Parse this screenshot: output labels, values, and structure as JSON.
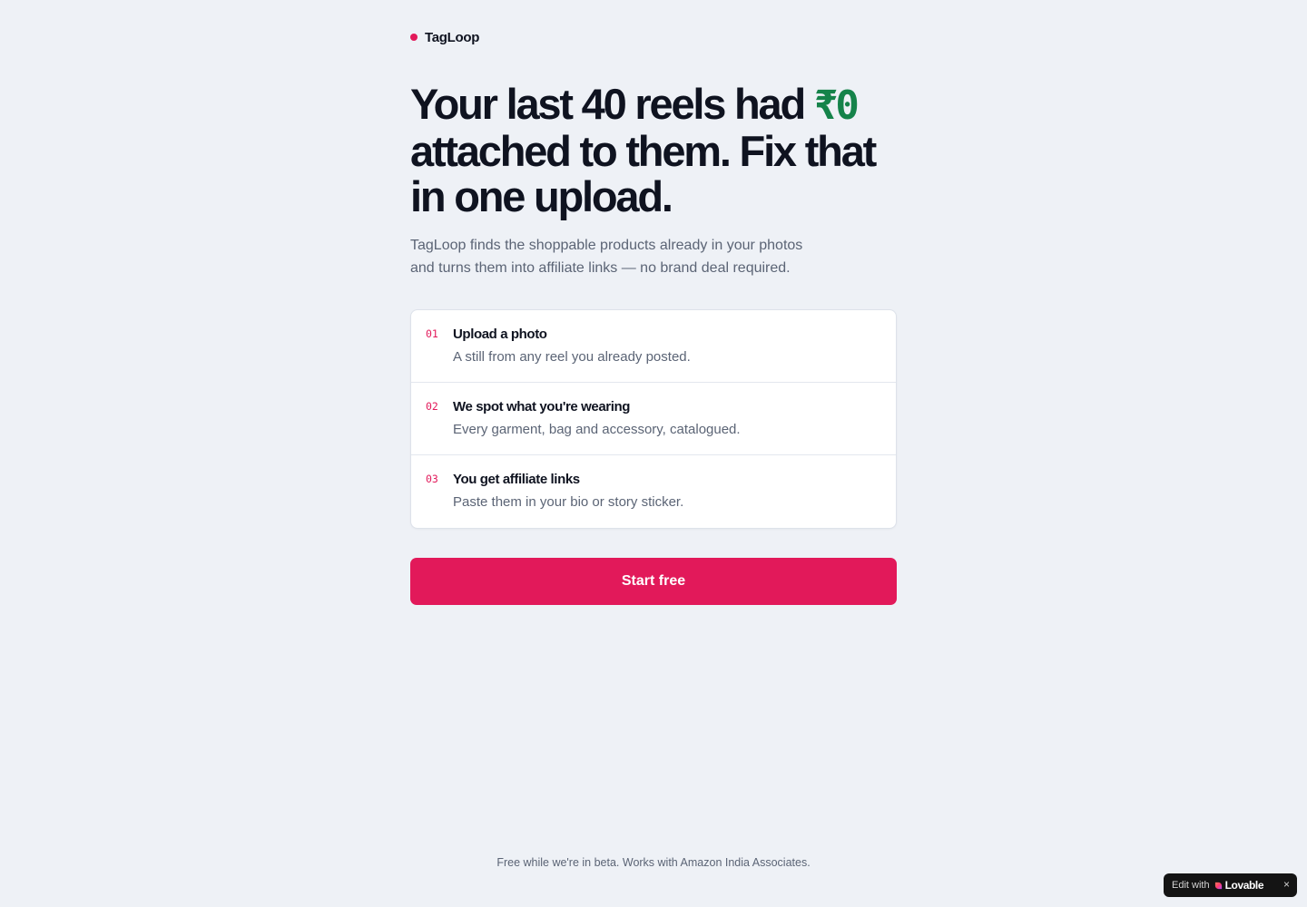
{
  "brand": {
    "name": "TagLoop",
    "dot_color": "#e2195a"
  },
  "hero": {
    "headline_before": "Your last 40 reels had ",
    "headline_amount": "₹0",
    "headline_after": " attached to them. Fix that in one upload.",
    "amount_color": "#15834a",
    "subhead": "TagLoop finds the shoppable products already in your photos and turns them into affiliate links — no brand deal required."
  },
  "steps": [
    {
      "number": "01",
      "title": "Upload a photo",
      "description": "A still from any reel you already posted."
    },
    {
      "number": "02",
      "title": "We spot what you're wearing",
      "description": "Every garment, bag and accessory, catalogued."
    },
    {
      "number": "03",
      "title": "You get affiliate links",
      "description": "Paste them in your bio or story sticker."
    }
  ],
  "cta": {
    "label": "Start free",
    "color": "#e2195a"
  },
  "footer": {
    "note": "Free while we're in beta. Works with Amazon India Associates."
  },
  "badge": {
    "label": "Edit with",
    "brand": "Lovable",
    "close": "×",
    "icon": "heart-icon"
  }
}
